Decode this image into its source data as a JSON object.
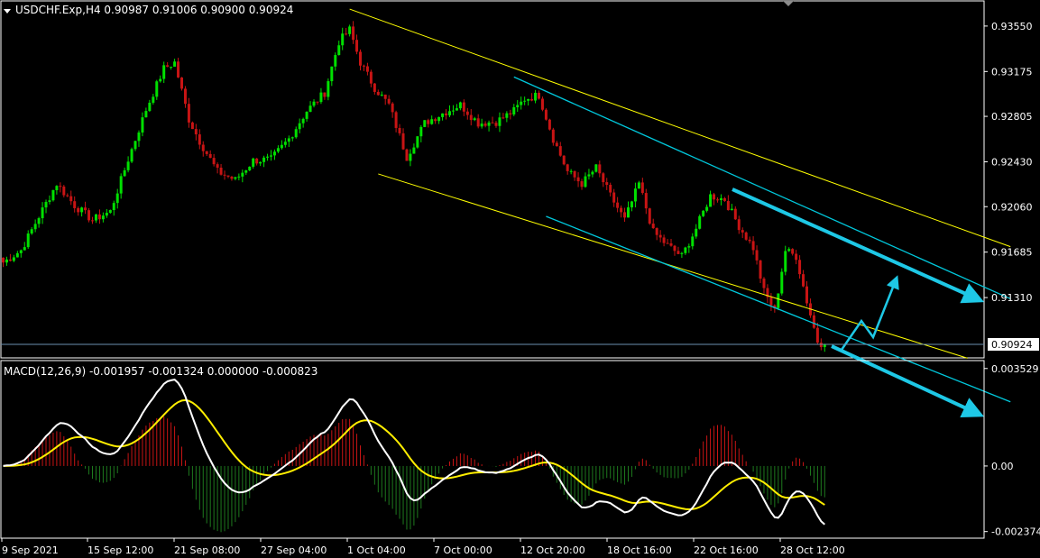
{
  "header": {
    "symbol_line": "USDCHF.Exp,H4  0.90987 0.91006 0.90900 0.90924"
  },
  "macd_panel": {
    "label": "MACD(12,26,9) -0.001957 -0.001324 0.000000 -0.000823"
  },
  "colors": {
    "background": "#000000",
    "bull_candle": "#00e000",
    "bear_candle": "#c81414",
    "channel_outer": "#ffff00",
    "channel_inner": "#00c8dc",
    "arrow": "#1ec8e6",
    "macd_line": "#ffffff",
    "signal_line": "#ffee00",
    "hist_positive": "#c81414",
    "hist_negative": "#1e7a1e",
    "axis": "#ffffff",
    "current_price_line": "#6b8fb0"
  },
  "chart_data": [
    {
      "type": "candlestick",
      "title": "USDCHF.Exp,H4",
      "y_ticks": [
        "0.93550",
        "0.93175",
        "0.92805",
        "0.92430",
        "0.92060",
        "0.91685",
        "0.91310"
      ],
      "ylim": [
        0.9082,
        0.9375
      ],
      "current_price": "0.90924",
      "x_ticks": [
        "9 Sep 2021",
        "15 Sep 12:00",
        "21 Sep 08:00",
        "27 Sep 04:00",
        "1 Oct 04:00",
        "7 Oct 00:00",
        "12 Oct 20:00",
        "18 Oct 16:00",
        "22 Oct 16:00",
        "28 Oct 12:00"
      ],
      "close_path": [
        [
          0,
          0.916
        ],
        [
          5,
          0.917
        ],
        [
          10,
          0.9198
        ],
        [
          15,
          0.9225
        ],
        [
          20,
          0.9207
        ],
        [
          25,
          0.9195
        ],
        [
          30,
          0.9202
        ],
        [
          35,
          0.9245
        ],
        [
          40,
          0.9286
        ],
        [
          45,
          0.932
        ],
        [
          48,
          0.9325
        ],
        [
          52,
          0.9278
        ],
        [
          55,
          0.926
        ],
        [
          60,
          0.9235
        ],
        [
          65,
          0.9228
        ],
        [
          70,
          0.9244
        ],
        [
          75,
          0.9245
        ],
        [
          80,
          0.9262
        ],
        [
          85,
          0.9285
        ],
        [
          90,
          0.93
        ],
        [
          94,
          0.9342
        ],
        [
          97,
          0.9352
        ],
        [
          100,
          0.9325
        ],
        [
          104,
          0.9304
        ],
        [
          108,
          0.929
        ],
        [
          113,
          0.9247
        ],
        [
          118,
          0.9275
        ],
        [
          123,
          0.9283
        ],
        [
          128,
          0.929
        ],
        [
          133,
          0.9275
        ],
        [
          138,
          0.9276
        ],
        [
          143,
          0.9285
        ],
        [
          146,
          0.9295
        ],
        [
          150,
          0.9298
        ],
        [
          154,
          0.9262
        ],
        [
          158,
          0.9235
        ],
        [
          162,
          0.9225
        ],
        [
          166,
          0.9238
        ],
        [
          170,
          0.9215
        ],
        [
          174,
          0.9195
        ],
        [
          178,
          0.9225
        ],
        [
          182,
          0.9185
        ],
        [
          186,
          0.9174
        ],
        [
          190,
          0.9165
        ],
        [
          194,
          0.9188
        ],
        [
          198,
          0.9215
        ],
        [
          202,
          0.9212
        ],
        [
          206,
          0.919
        ],
        [
          210,
          0.9172
        ],
        [
          213,
          0.9136
        ],
        [
          216,
          0.912
        ],
        [
          219,
          0.917
        ],
        [
          222,
          0.9165
        ],
        [
          225,
          0.9128
        ],
        [
          228,
          0.9095
        ],
        [
          230,
          0.9092
        ]
      ],
      "channels": [
        {
          "name": "",
          "color": "#ffff00",
          "start": [
            97,
            0.9369
          ],
          "end": [
            282,
            0.9173
          ]
        },
        {
          "name": "",
          "color": "#ffff00",
          "start": [
            105,
            0.9233
          ],
          "end": [
            270,
            0.9081
          ]
        },
        {
          "name": "",
          "color": "#00c8dc",
          "start": [
            143,
            0.9313
          ],
          "end": [
            282,
            0.913
          ]
        },
        {
          "name": "",
          "color": "#00c8dc",
          "start": [
            152,
            0.9198
          ],
          "end": [
            282,
            0.9045
          ]
        }
      ]
    },
    {
      "type": "macd",
      "title": "MACD(12,26,9)",
      "params": [
        12,
        26,
        9
      ],
      "values": {
        "main": "-0.001957",
        "signal": "-0.001324",
        "level": "0.000000",
        "histogram": "-0.000823"
      },
      "y_ticks": [
        "0.003529",
        "0.00",
        "-0.002374"
      ],
      "ylim": [
        -0.00258,
        0.00375
      ]
    }
  ]
}
